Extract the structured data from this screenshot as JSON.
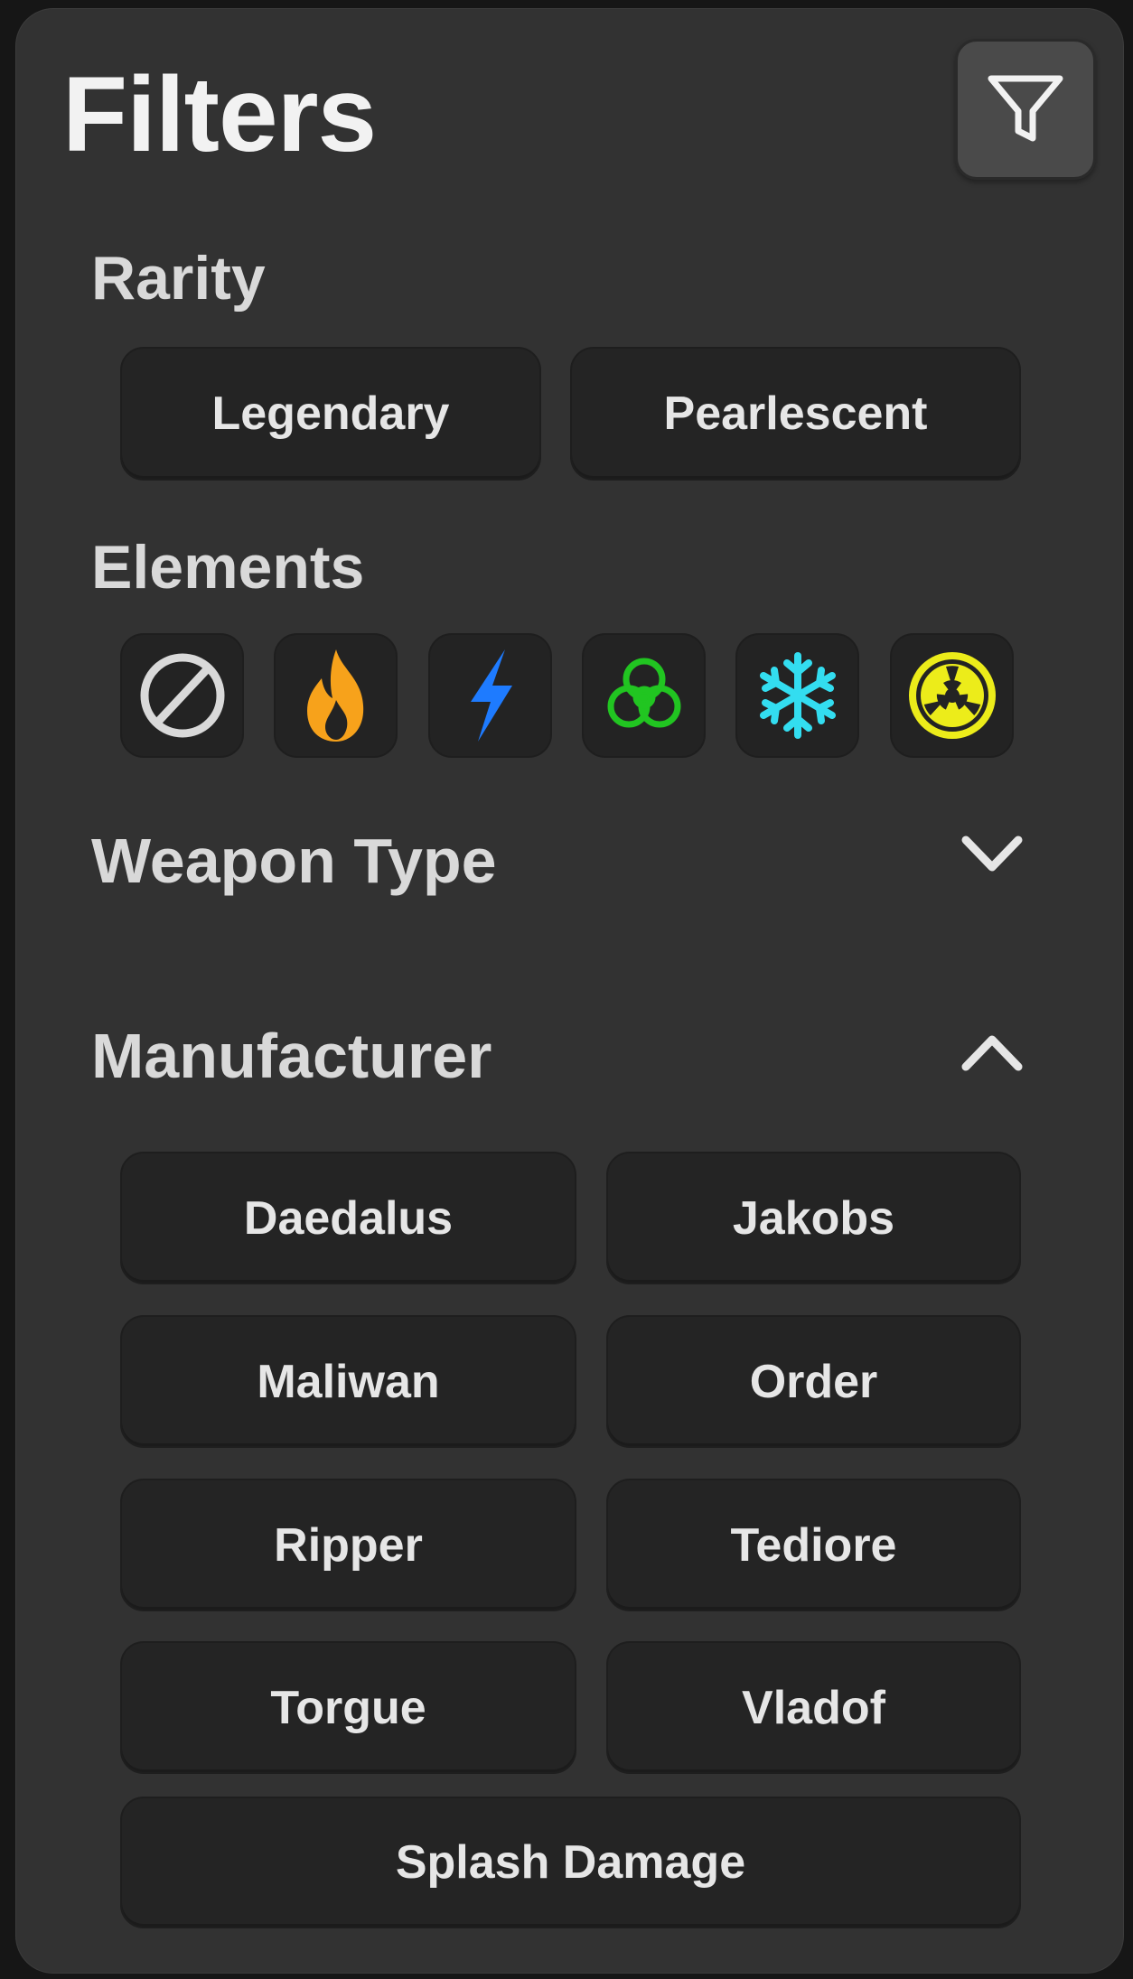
{
  "header": {
    "title": "Filters",
    "filter_icon": "funnel-icon"
  },
  "rarity": {
    "title": "Rarity",
    "options": [
      "Legendary",
      "Pearlescent"
    ]
  },
  "elements": {
    "title": "Elements",
    "icons": [
      {
        "name": "none-icon",
        "color": "#d9d9d9"
      },
      {
        "name": "fire-icon",
        "color": "#f7a21b"
      },
      {
        "name": "shock-icon",
        "color": "#1e7bff"
      },
      {
        "name": "biohazard-icon",
        "color": "#21c521"
      },
      {
        "name": "snowflake-icon",
        "color": "#33ddf0"
      },
      {
        "name": "radiation-icon",
        "color": "#ecec1a"
      }
    ]
  },
  "weapon_type": {
    "title": "Weapon Type",
    "state": "collapsed",
    "chevron_icon": "chevron-down-icon"
  },
  "manufacturer": {
    "title": "Manufacturer",
    "state": "expanded",
    "chevron_icon": "chevron-up-icon",
    "options": [
      "Daedalus",
      "Jakobs",
      "Maliwan",
      "Order",
      "Ripper",
      "Tediore",
      "Torgue",
      "Vladof",
      "Splash Damage"
    ]
  },
  "colors": {
    "panel_bg": "#323232",
    "chip_bg": "#242424",
    "text": "#e6e6e6"
  }
}
